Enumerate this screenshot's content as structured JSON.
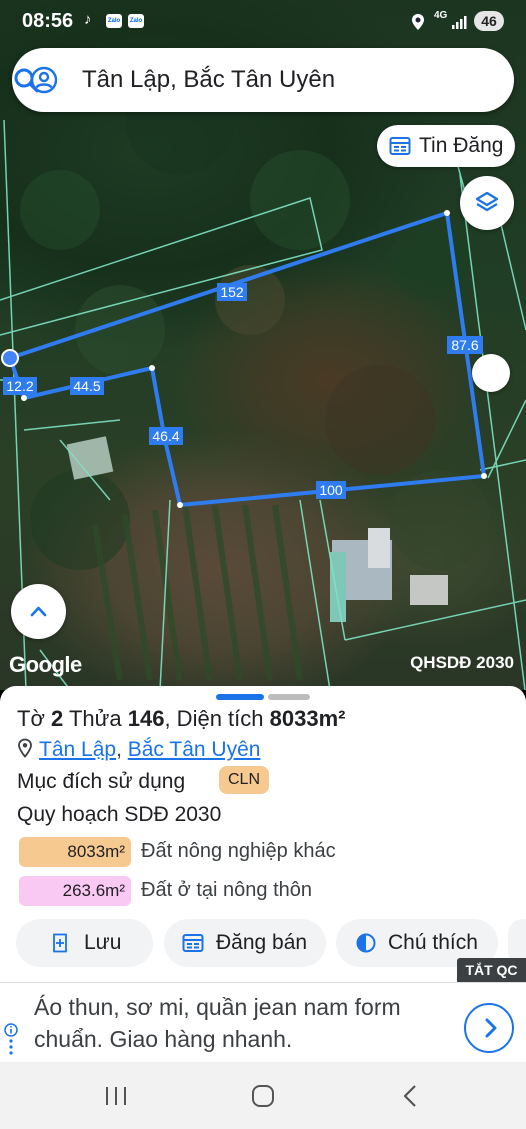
{
  "status_bar": {
    "time": "08:56",
    "network": "4G",
    "battery": "46",
    "app_icons": [
      "tiktok-icon",
      "zalo-icon",
      "zalo-icon"
    ]
  },
  "search": {
    "query": "Tân Lập, Bắc Tân Uyên"
  },
  "map": {
    "post_button_label": "Tin Đăng",
    "google_logo": "Google",
    "layer_label": "QHSDĐ 2030",
    "edge_lengths": [
      "152",
      "87.6",
      "12.2",
      "44.5",
      "46.4",
      "100"
    ]
  },
  "sheet": {
    "title_prefix": "Tờ",
    "sheet_number": "2",
    "parcel_prefix": "Thửa",
    "parcel_number": "146",
    "area_prefix": ", Diện tích",
    "area_value": "8033m²",
    "location_commune": "Tân Lập",
    "location_sep": ",",
    "location_district": "Bắc Tân Uyên",
    "purpose_label": "Mục đích sử dụng",
    "purpose_code": "CLN",
    "planning_title": "Quy hoạch SDĐ 2030",
    "planning_rows": [
      {
        "area": "8033m²",
        "label": "Đất nông nghiệp khác",
        "color": "#f6c990"
      },
      {
        "area": "263.6m²",
        "label": "Đất ở tại nông thôn",
        "color": "#f9c9f4"
      }
    ],
    "actions": [
      {
        "label": "Lưu",
        "icon": "bookmark-add-icon"
      },
      {
        "label": "Đăng bán",
        "icon": "listing-icon"
      },
      {
        "label": "Chú thích",
        "icon": "legend-icon"
      }
    ]
  },
  "ad": {
    "close_label": "TẮT QC",
    "text": "Áo thun, sơ mi, quần jean nam form chuẩn. Giao hàng nhanh."
  },
  "colors": {
    "accent": "#1a73e8",
    "parcel_line": "#2f7cf0",
    "cadastral_line": "#7fe3c4"
  }
}
